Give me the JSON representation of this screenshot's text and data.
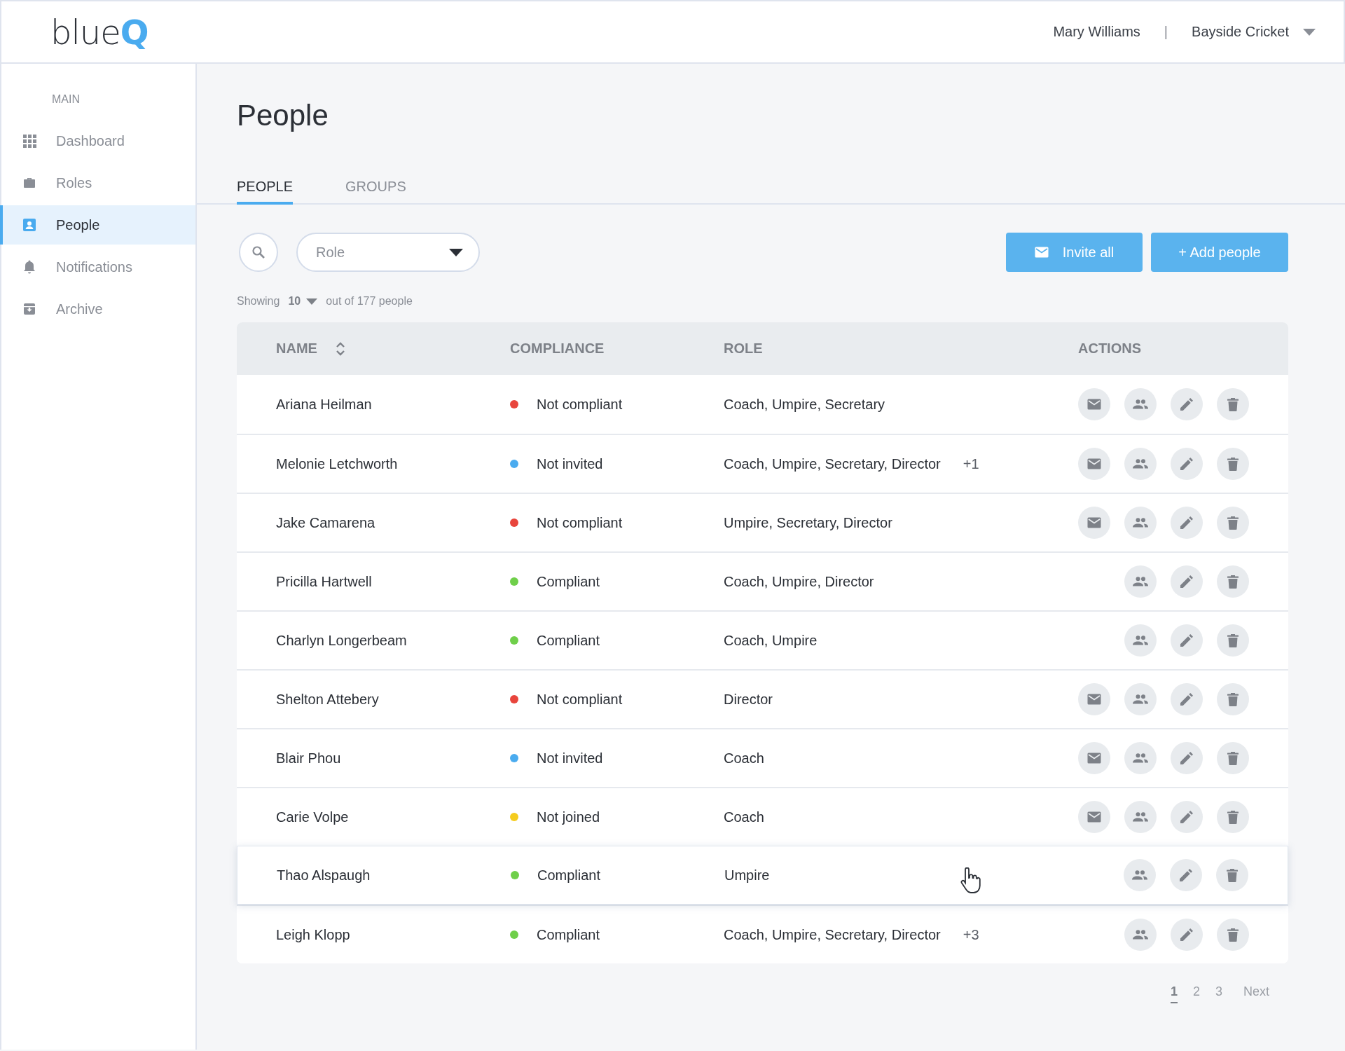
{
  "header": {
    "logo": {
      "text": "blue",
      "accent": "Q"
    },
    "user": "Mary Williams",
    "separator": "|",
    "club": "Bayside Cricket"
  },
  "sidebar": {
    "section": "MAIN",
    "items": [
      {
        "label": "Dashboard",
        "selected": false
      },
      {
        "label": "Roles",
        "selected": false
      },
      {
        "label": "People",
        "selected": true
      },
      {
        "label": "Notifications",
        "selected": false
      },
      {
        "label": "Archive",
        "selected": false
      }
    ]
  },
  "page_title": "People",
  "tabs": [
    {
      "label": "PEOPLE",
      "selected": true
    },
    {
      "label": "GROUPS",
      "selected": false
    }
  ],
  "filter": {
    "placeholder": "Role"
  },
  "buttons": {
    "invite": "Invite all",
    "add": "+ Add people"
  },
  "showing": {
    "prefix": "Showing",
    "count": "10",
    "suffix": "out of 177 people"
  },
  "table": {
    "columns": [
      "NAME",
      "COMPLIANCE",
      "ROLE",
      "ACTIONS"
    ],
    "rows": [
      {
        "name": "Ariana Heilman",
        "status": "Not compliant",
        "color": "#e8453c",
        "role": "Coach, Umpire, Secretary",
        "can_invite": true,
        "hovered": false
      },
      {
        "name": "Melonie Letchworth",
        "status": "Not invited",
        "color": "#4aabef",
        "role": "Coach, Umpire, Secretary, Director",
        "extra": "+1",
        "can_invite": true,
        "hovered": false
      },
      {
        "name": "Jake Camarena",
        "status": "Not compliant",
        "color": "#e8453c",
        "role": "Umpire, Secretary, Director",
        "can_invite": true,
        "hovered": false
      },
      {
        "name": "Pricilla Hartwell",
        "status": "Compliant",
        "color": "#6fcf4a",
        "role": "Coach, Umpire, Director",
        "can_invite": false,
        "hovered": false
      },
      {
        "name": "Charlyn Longerbeam",
        "status": "Compliant",
        "color": "#6fcf4a",
        "role": "Coach, Umpire",
        "can_invite": false,
        "hovered": false
      },
      {
        "name": "Shelton Attebery",
        "status": "Not compliant",
        "color": "#e8453c",
        "role": "Director",
        "can_invite": true,
        "hovered": false
      },
      {
        "name": "Blair Phou",
        "status": "Not invited",
        "color": "#4aabef",
        "role": "Coach",
        "can_invite": true,
        "hovered": false
      },
      {
        "name": "Carie Volpe",
        "status": "Not joined",
        "color": "#f5cc1e",
        "role": "Coach",
        "can_invite": true,
        "hovered": false
      },
      {
        "name": "Thao Alspaugh",
        "status": "Compliant",
        "color": "#6fcf4a",
        "role": "Umpire",
        "can_invite": false,
        "hovered": true
      },
      {
        "name": "Leigh Klopp",
        "status": "Compliant",
        "color": "#6fcf4a",
        "role": "Coach, Umpire, Secretary, Director",
        "extra": "+3",
        "can_invite": false,
        "hovered": false
      }
    ]
  },
  "pagination": {
    "pages": [
      {
        "label": "1",
        "selected": true
      },
      {
        "label": "2",
        "selected": false
      },
      {
        "label": "3",
        "selected": false
      }
    ],
    "next": "Next"
  }
}
